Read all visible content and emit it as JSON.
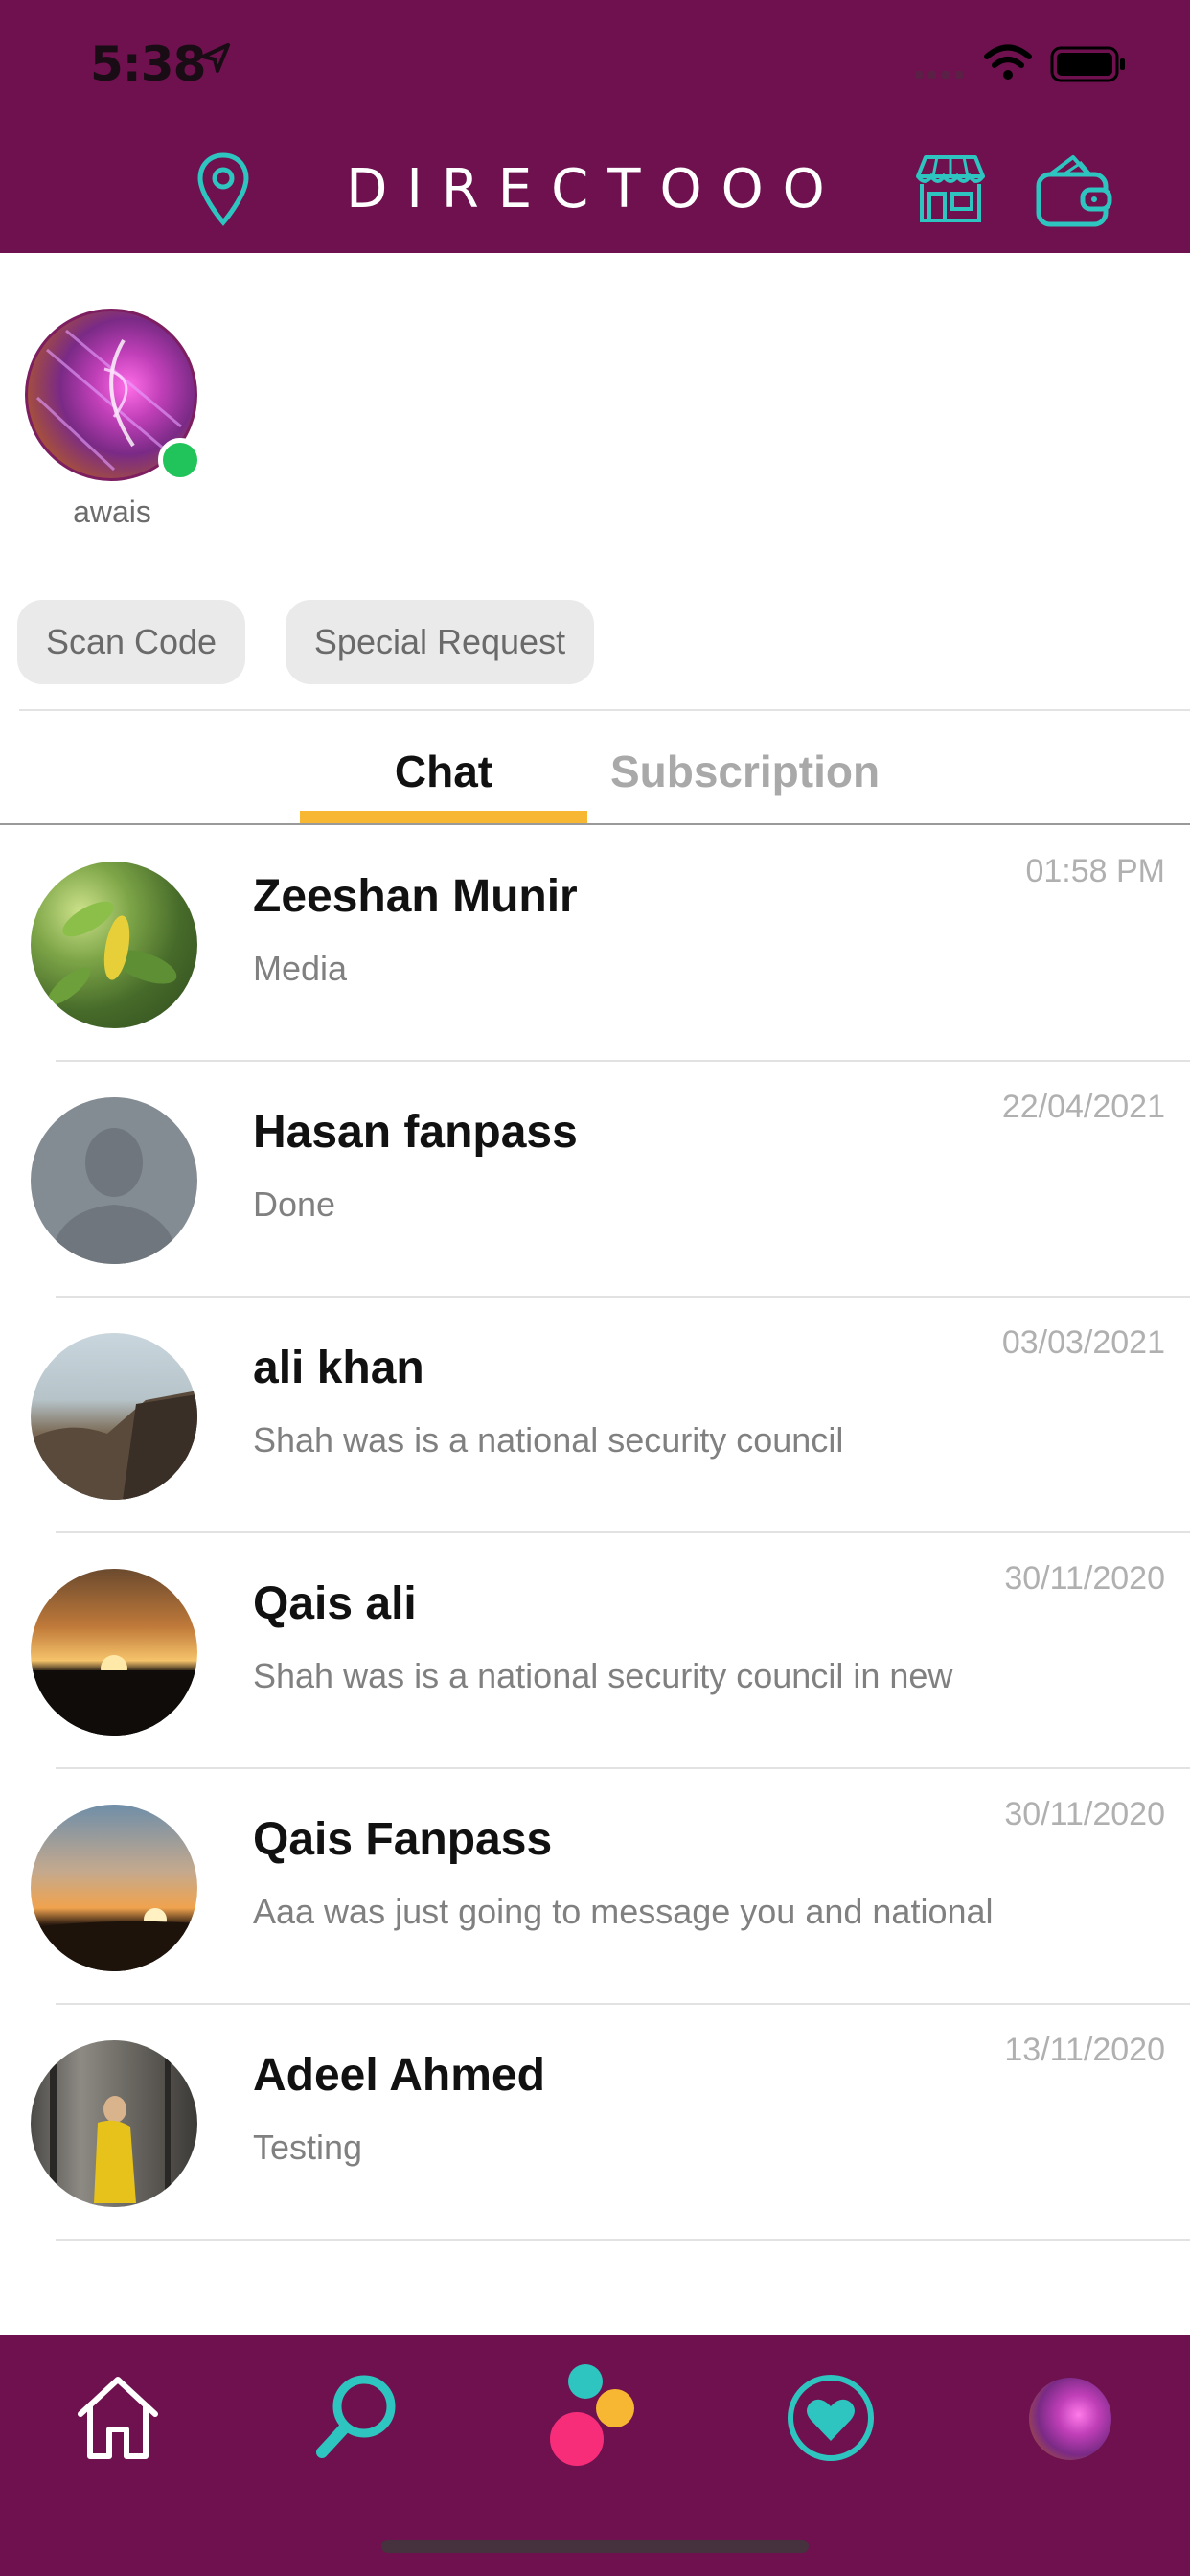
{
  "status_bar": {
    "time": "5:38"
  },
  "header": {
    "brand": "DIRECTOOO"
  },
  "story": {
    "name": "awais",
    "online": true
  },
  "actions": {
    "scan_label": "Scan Code",
    "special_label": "Special Request"
  },
  "tabs": [
    {
      "label": "Chat",
      "active": true
    },
    {
      "label": "Subscription",
      "active": false
    }
  ],
  "chats": [
    {
      "name": "Zeeshan Munir",
      "message": "Media",
      "time": "01:58 PM"
    },
    {
      "name": "Hasan fanpass",
      "message": "Done",
      "time": "22/04/2021"
    },
    {
      "name": "ali khan",
      "message": "Shah was is a national security council",
      "time": "03/03/2021"
    },
    {
      "name": "Qais ali",
      "message": "Shah was is a national security council in new",
      "time": "30/11/2020"
    },
    {
      "name": "Qais Fanpass",
      "message": "Aaa was just going to message you and national",
      "time": "30/11/2020"
    },
    {
      "name": "Adeel Ahmed",
      "message": "Testing",
      "time": "13/11/2020"
    }
  ],
  "tab_bar": {
    "icons": [
      "home-icon",
      "search-icon",
      "dots-logo-icon",
      "heart-icon",
      "profile-avatar"
    ]
  },
  "colors": {
    "brand": "#6e114e",
    "accent_teal": "#2ec4c0",
    "tab_indicator": "#f7b733",
    "online": "#21c45a",
    "dot_pink": "#f72d7a",
    "dot_yellow": "#f7b733"
  }
}
